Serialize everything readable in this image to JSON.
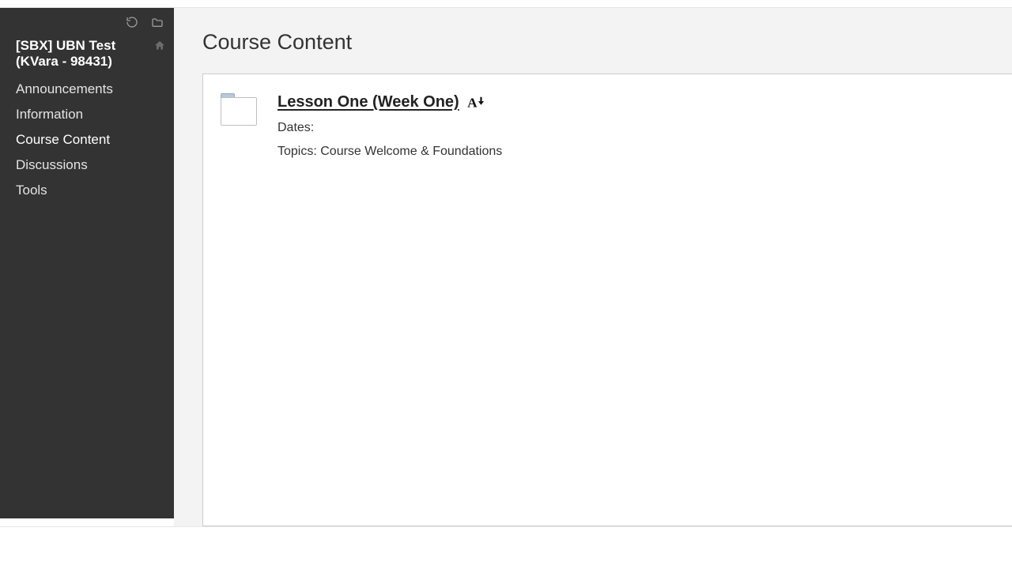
{
  "sidebar": {
    "course_title": "[SBX] UBN Test (KVara - 98431)",
    "items": [
      {
        "label": "Announcements"
      },
      {
        "label": "Information"
      },
      {
        "label": "Course Content"
      },
      {
        "label": "Discussions"
      },
      {
        "label": "Tools"
      }
    ],
    "active_index": 2
  },
  "page": {
    "title": "Course Content"
  },
  "content": {
    "items": [
      {
        "title": "Lesson One (Week One)",
        "dates_label": "Dates:",
        "dates_value": "",
        "topics": "Topics: Course Welcome & Foundations"
      }
    ]
  }
}
